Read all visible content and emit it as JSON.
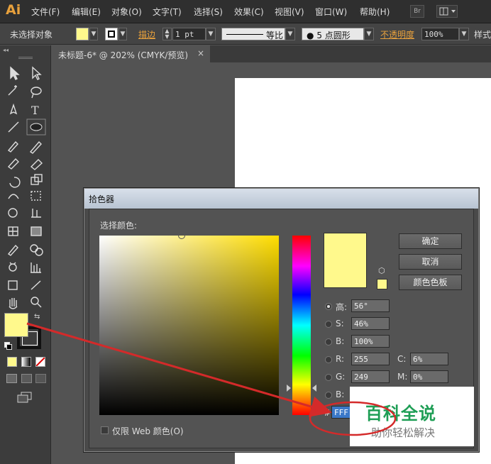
{
  "app": {
    "logo": "Ai"
  },
  "menu": [
    "文件(F)",
    "编辑(E)",
    "对象(O)",
    "文字(T)",
    "选择(S)",
    "效果(C)",
    "视图(V)",
    "窗口(W)",
    "帮助(H)"
  ],
  "bridge_label": "Br",
  "control_bar": {
    "selection": "未选择对象",
    "stroke_label": "描边",
    "stroke_value": "1 pt",
    "profile_label": "等比",
    "brush_label": "5 点圆形",
    "opacity_label": "不透明度",
    "opacity_value": "100%",
    "style_label": "样式"
  },
  "document_tab": {
    "title": "未标题-6* @ 202% (CMYK/预览)",
    "close": "×"
  },
  "color_picker": {
    "title": "拾色器",
    "select_label": "选择颜色:",
    "current_color": "#fff98c",
    "buttons": {
      "ok": "确定",
      "cancel": "取消",
      "swatches": "颜色色板"
    },
    "fields": {
      "h_label": "高:",
      "h": "56°",
      "s_label": "S:",
      "s": "46%",
      "b_label": "B:",
      "b": "100%",
      "r_label": "R:",
      "r": "255",
      "g_label": "G:",
      "g": "249",
      "b2_label": "B:",
      "b2": "",
      "c_label": "C:",
      "c": "6%",
      "m_label": "M:",
      "m": "0%",
      "hex_label": "#",
      "hex": "FFF"
    },
    "web_only": "仅限 Web 颜色(O)"
  },
  "watermark": {
    "title": "百科全说",
    "subtitle": "助你轻松解决"
  },
  "colors": {
    "fill": "#fff98c",
    "annotation": "#d42a2a"
  }
}
